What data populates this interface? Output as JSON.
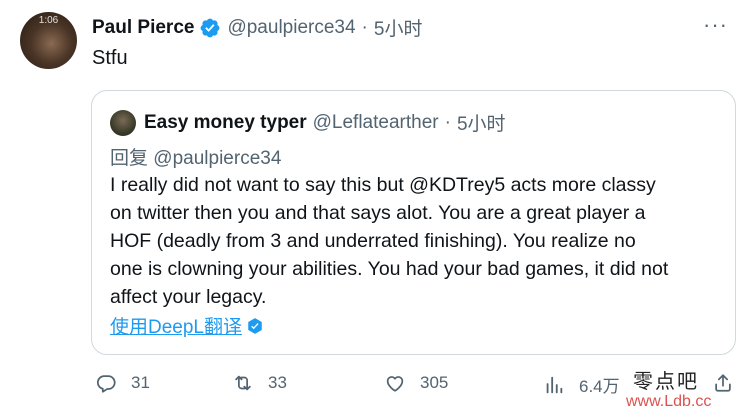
{
  "tweet": {
    "avatar_time": "1:06",
    "author_name": "Paul Pierce",
    "handle": "@paulpierce34",
    "separator": "·",
    "time_ago": "5小时",
    "more": "···",
    "text": "Stfu"
  },
  "quote": {
    "author_name": "Easy money typer",
    "handle": "@Leflatearther",
    "separator": "·",
    "time_ago": "5小时",
    "reply_prefix": "回复",
    "reply_mention": "@paulpierce34",
    "body_lines": [
      "I really did not want to say this but @KDTrey5  acts more classy",
      "on twitter then you and that says alot. You are a great player a",
      "HOF (deadly from 3 and underrated finishing).  You realize no",
      "one is clowning your abilities. You had your bad games, it did not",
      "affect your legacy."
    ],
    "translate_label": "使用DeepL翻译"
  },
  "actions": {
    "reply_count": "31",
    "retweet_count": "33",
    "like_count": "305",
    "views_count": "6.4万"
  },
  "watermark": {
    "chars": "零点吧",
    "url": "www.Ldb.cc"
  },
  "colors": {
    "accent": "#1d9bf0",
    "muted": "#536471",
    "border": "#cfd9de",
    "text": "#0f1419"
  },
  "icons": [
    "verified-badge-icon",
    "more-icon",
    "reply-icon",
    "retweet-icon",
    "like-icon",
    "views-icon",
    "share-icon",
    "deepl-icon"
  ]
}
